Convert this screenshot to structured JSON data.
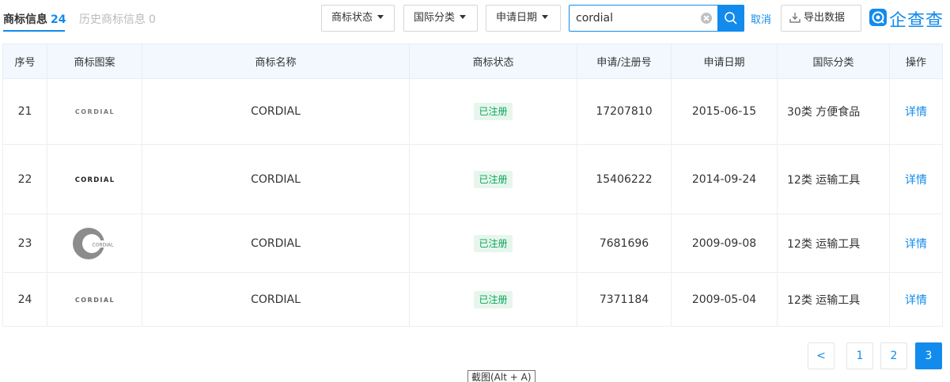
{
  "tabs": [
    {
      "label": "商标信息",
      "count": "24"
    },
    {
      "label": "历史商标信息",
      "count": "0"
    }
  ],
  "filters": {
    "status": "商标状态",
    "intl_class": "国际分类",
    "apply_date": "申请日期"
  },
  "search": {
    "value": "cordial",
    "cancel": "取消"
  },
  "export_label": "导出数据",
  "brand": {
    "name": "企查查"
  },
  "colors": {
    "accent": "#128bed",
    "name_red": "#fd485e",
    "status_green": "#09a55c",
    "header_bg": "#f2f8fe"
  },
  "table": {
    "headers": [
      "序号",
      "商标图案",
      "商标名称",
      "商标状态",
      "申请/注册号",
      "申请日期",
      "国际分类",
      "操作"
    ],
    "rows": [
      {
        "idx": "21",
        "logo_text": "CORDIAL",
        "name": "CORDIAL",
        "status": "已注册",
        "reg_no": "17207810",
        "date": "2015-06-15",
        "class": "30类 方便食品",
        "action": "详情"
      },
      {
        "idx": "22",
        "logo_text": "CORDIAL",
        "name": "CORDIAL",
        "status": "已注册",
        "reg_no": "15406222",
        "date": "2014-09-24",
        "class": "12类 运输工具",
        "action": "详情"
      },
      {
        "idx": "23",
        "logo_text": "CORDIAL",
        "name": "CORDIAL",
        "status": "已注册",
        "reg_no": "7681696",
        "date": "2009-09-08",
        "class": "12类 运输工具",
        "action": "详情"
      },
      {
        "idx": "24",
        "logo_text": "CORDIAL",
        "name": "CORDIAL",
        "status": "已注册",
        "reg_no": "7371184",
        "date": "2009-05-04",
        "class": "12类 运输工具",
        "action": "详情"
      }
    ]
  },
  "pagination": {
    "prev": "<",
    "pages": [
      "1",
      "2",
      "3"
    ],
    "current": "3"
  },
  "tooltip": "截图(Alt + A)"
}
